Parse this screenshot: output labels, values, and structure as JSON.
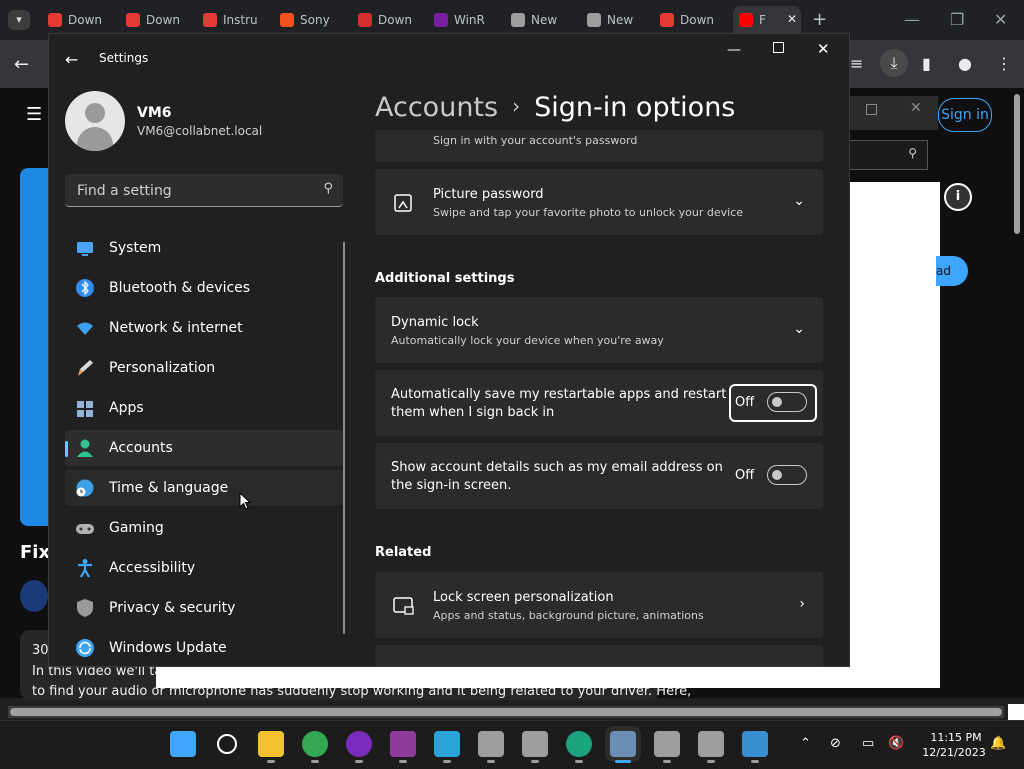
{
  "browser": {
    "tabs": [
      {
        "label": "Down",
        "color": "#e53935"
      },
      {
        "label": "Down",
        "color": "#e53935"
      },
      {
        "label": "Instru",
        "color": "#e53935"
      },
      {
        "label": "Sony",
        "color": "#f4511e"
      },
      {
        "label": "Down",
        "color": "#d32f2f"
      },
      {
        "label": "WinR",
        "color": "#7b1fa2"
      },
      {
        "label": "New",
        "color": "#9e9e9e"
      },
      {
        "label": "New",
        "color": "#9e9e9e"
      },
      {
        "label": "Down",
        "color": "#e53935"
      },
      {
        "label": "F",
        "color": "#ff0000"
      }
    ],
    "new_tab": "+",
    "signin_label": "Sign in",
    "ad_label": "ad"
  },
  "youtube": {
    "video_title_fragment": "Fix",
    "desc_count": "30",
    "desc_line1": "In this video we'll tak",
    "desc_line2": "to find your audio or microphone has suddenly stop working and it being related to your driver. Here,"
  },
  "settings": {
    "window_title": "Settings",
    "user": {
      "name": "VM6",
      "email": "VM6@collabnet.local"
    },
    "search_placeholder": "Find a setting",
    "nav": [
      {
        "label": "System",
        "icon": "monitor-icon",
        "color": "#4aa3ff"
      },
      {
        "label": "Bluetooth & devices",
        "icon": "bluetooth-icon",
        "color": "#2f8df0"
      },
      {
        "label": "Network & internet",
        "icon": "wifi-icon",
        "color": "#3ca0f0"
      },
      {
        "label": "Personalization",
        "icon": "brush-icon",
        "color": "#e8a25a"
      },
      {
        "label": "Apps",
        "icon": "apps-icon",
        "color": "#8fb3d9"
      },
      {
        "label": "Accounts",
        "icon": "person-icon",
        "color": "#2fc48f"
      },
      {
        "label": "Time & language",
        "icon": "globe-clock-icon",
        "color": "#3f9ee8"
      },
      {
        "label": "Gaming",
        "icon": "gamepad-icon",
        "color": "#b0b0b0"
      },
      {
        "label": "Accessibility",
        "icon": "accessibility-icon",
        "color": "#3ea6ff"
      },
      {
        "label": "Privacy & security",
        "icon": "shield-icon",
        "color": "#9a9a9a"
      },
      {
        "label": "Windows Update",
        "icon": "update-icon",
        "color": "#3ea6ff"
      }
    ],
    "breadcrumb": {
      "parent": "Accounts",
      "separator": "›",
      "current": "Sign-in options"
    },
    "password_sub": "Sign in with your account's password",
    "picture_password": {
      "title": "Picture password",
      "subtitle": "Swipe and tap your favorite photo to unlock your device"
    },
    "additional_heading": "Additional settings",
    "dynamic_lock": {
      "title": "Dynamic lock",
      "subtitle": "Automatically lock your device when you're away"
    },
    "restart_apps": {
      "text1": "Automatically save my restartable apps and restart",
      "text2": "them when I sign back in",
      "state": "Off"
    },
    "account_details": {
      "text1": "Show account details such as my email address on",
      "text2": "the sign-in screen.",
      "state": "Off"
    },
    "related_heading": "Related",
    "lock_screen": {
      "title": "Lock screen personalization",
      "subtitle": "Apps and status, background picture, animations"
    }
  },
  "taskbar": {
    "time": "11:15 PM",
    "date": "12/21/2023"
  }
}
